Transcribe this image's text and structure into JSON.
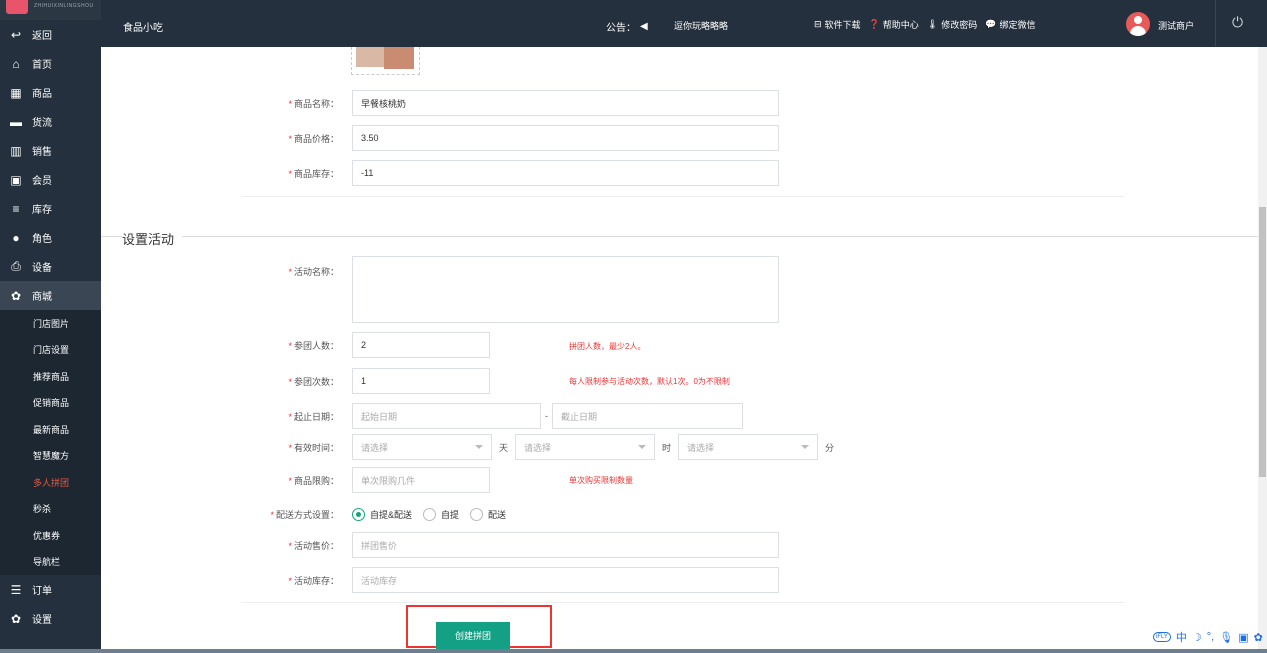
{
  "sidebar": {
    "logo_text": "ZHIHUIXINLINGSHOU",
    "items": [
      {
        "label": "返回",
        "icon": "arrow-back-icon"
      },
      {
        "label": "首页",
        "icon": "home-icon"
      },
      {
        "label": "商品",
        "icon": "grid-icon"
      },
      {
        "label": "货流",
        "icon": "truck-icon"
      },
      {
        "label": "销售",
        "icon": "bar-chart-icon"
      },
      {
        "label": "会员",
        "icon": "id-card-icon"
      },
      {
        "label": "库存",
        "icon": "database-icon"
      },
      {
        "label": "角色",
        "icon": "user-icon"
      },
      {
        "label": "设备",
        "icon": "printer-icon"
      },
      {
        "label": "商城",
        "icon": "gear-icon"
      }
    ],
    "sub_items": [
      {
        "label": "门店图片"
      },
      {
        "label": "门店设置"
      },
      {
        "label": "推荐商品"
      },
      {
        "label": "促销商品"
      },
      {
        "label": "最新商品"
      },
      {
        "label": "智慧魔方"
      },
      {
        "label": "多人拼团"
      },
      {
        "label": "秒杀"
      },
      {
        "label": "优惠券"
      },
      {
        "label": "导航栏"
      }
    ],
    "bottom_items": [
      {
        "label": "订单",
        "icon": "list-icon"
      },
      {
        "label": "设置",
        "icon": "gear-icon"
      }
    ],
    "active_sub": "多人拼团"
  },
  "topbar": {
    "title": "食品小吃",
    "notice_label": "公告：",
    "notice_link": "逗你玩略略略",
    "tools": [
      {
        "label": "软件下载",
        "icon": "download-icon"
      },
      {
        "label": "帮助中心",
        "icon": "help-icon"
      },
      {
        "label": "修改密码",
        "icon": "thermometer-icon"
      },
      {
        "label": "绑定微信",
        "icon": "wechat-icon"
      }
    ],
    "user": "测试商户"
  },
  "product": {
    "name_label": "商品名称：",
    "name_value": "早餐核桃奶",
    "price_label": "商品价格：",
    "price_value": "3.50",
    "stock_label": "商品库存：",
    "stock_value": "-11"
  },
  "activity": {
    "legend": "设置活动",
    "name_label": "活动名称：",
    "members_label": "参团人数：",
    "members_value": "2",
    "members_hint": "拼团人数，最少2人。",
    "times_label": "参团次数：",
    "times_value": "1",
    "times_hint": "每人限制参与活动次数，默认1次。0为不限制",
    "date_label": "起止日期：",
    "start_placeholder": "起始日期",
    "date_sep": "-",
    "end_placeholder": "截止日期",
    "valid_label": "有效时间：",
    "select_placeholder": "请选择",
    "unit_day": "天",
    "unit_hour": "时",
    "unit_min": "分",
    "limit_label": "商品限购：",
    "limit_placeholder": "单次限购几件",
    "limit_hint": "单次购买限制数量",
    "delivery_label": "配送方式设置：",
    "delivery_options": [
      "自提&配送",
      "自提",
      "配送"
    ],
    "delivery_selected": 0,
    "price_label": "活动售价：",
    "price_placeholder": "拼团售价",
    "stock_label": "活动库存：",
    "stock_placeholder": "活动库存",
    "submit": "创建拼团"
  },
  "ime": {
    "label": "中"
  }
}
